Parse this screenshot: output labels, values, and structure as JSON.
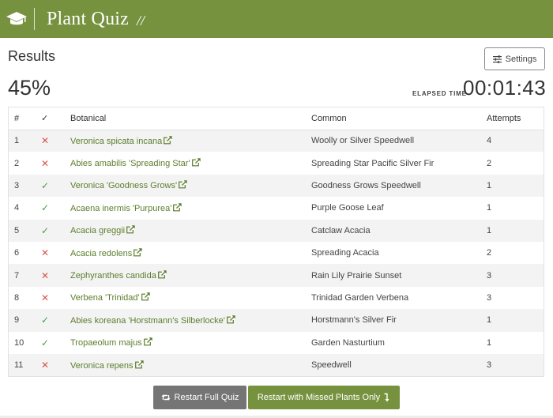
{
  "header": {
    "title": "Plant Quiz",
    "slashes": "//",
    "icon": "graduation-cap-icon",
    "background_color": "#76923f"
  },
  "results": {
    "title": "Results",
    "score": "45%",
    "elapsed_label": "ELAPSED TIME",
    "elapsed_time": "00:01:43",
    "settings_label": "Settings"
  },
  "table": {
    "headers": {
      "num": "#",
      "check": "✓",
      "botanical": "Botanical",
      "common": "Common",
      "attempts": "Attempts"
    },
    "rows": [
      {
        "num": "1",
        "correct": false,
        "botanical": "Veronica spicata incana",
        "common": "Woolly or Silver Speedwell",
        "attempts": "4"
      },
      {
        "num": "2",
        "correct": false,
        "botanical": "Abies amabilis 'Spreading Star'",
        "common": "Spreading Star Pacific Silver Fir",
        "attempts": "2"
      },
      {
        "num": "3",
        "correct": true,
        "botanical": "Veronica 'Goodness Grows'",
        "common": "Goodness Grows Speedwell",
        "attempts": "1"
      },
      {
        "num": "4",
        "correct": true,
        "botanical": "Acaena inermis 'Purpurea'",
        "common": "Purple Goose Leaf",
        "attempts": "1"
      },
      {
        "num": "5",
        "correct": true,
        "botanical": "Acacia greggii",
        "common": "Catclaw Acacia",
        "attempts": "1"
      },
      {
        "num": "6",
        "correct": false,
        "botanical": "Acacia redolens",
        "common": "Spreading Acacia",
        "attempts": "2"
      },
      {
        "num": "7",
        "correct": false,
        "botanical": "Zephyranthes candida",
        "common": "Rain Lily Prairie Sunset",
        "attempts": "3"
      },
      {
        "num": "8",
        "correct": false,
        "botanical": "Verbena 'Trinidad'",
        "common": "Trinidad Garden Verbena",
        "attempts": "3"
      },
      {
        "num": "9",
        "correct": true,
        "botanical": "Abies koreana 'Horstmann's Silberlocke'",
        "common": "Horstmann's Silver Fir",
        "attempts": "1"
      },
      {
        "num": "10",
        "correct": true,
        "botanical": "Tropaeolum majus",
        "common": "Garden Nasturtium",
        "attempts": "1"
      },
      {
        "num": "11",
        "correct": false,
        "botanical": "Veronica repens",
        "common": "Speedwell",
        "attempts": "3"
      }
    ],
    "marks": {
      "correct": "✓",
      "wrong": "✕"
    }
  },
  "buttons": {
    "restart_full": "Restart Full Quiz",
    "restart_missed": "Restart with Missed Plants Only"
  },
  "colors": {
    "brand_green": "#76923f",
    "link_green": "#5d7d2e",
    "wrong_red": "#d9534f",
    "right_green": "#4a9a4a",
    "restart_gray": "#757575"
  }
}
